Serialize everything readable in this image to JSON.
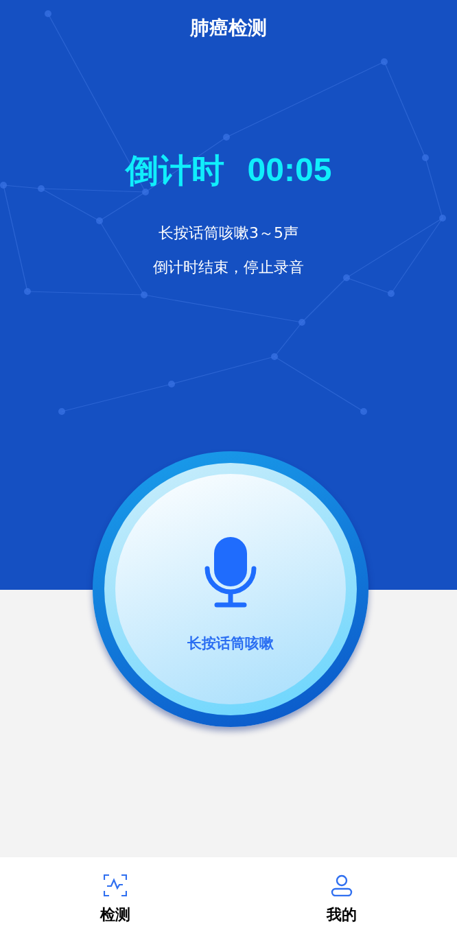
{
  "header": {
    "title": "肺癌检测"
  },
  "countdown": {
    "label": "倒计时",
    "time": "00:05"
  },
  "instructions": [
    "长按话筒咳嗽3～5声",
    "倒计时结束，停止录音"
  ],
  "record_button": {
    "label": "长按话筒咳嗽"
  },
  "tab_bar": [
    {
      "label": "检测",
      "kind": "scan"
    },
    {
      "label": "我的",
      "kind": "profile"
    }
  ]
}
